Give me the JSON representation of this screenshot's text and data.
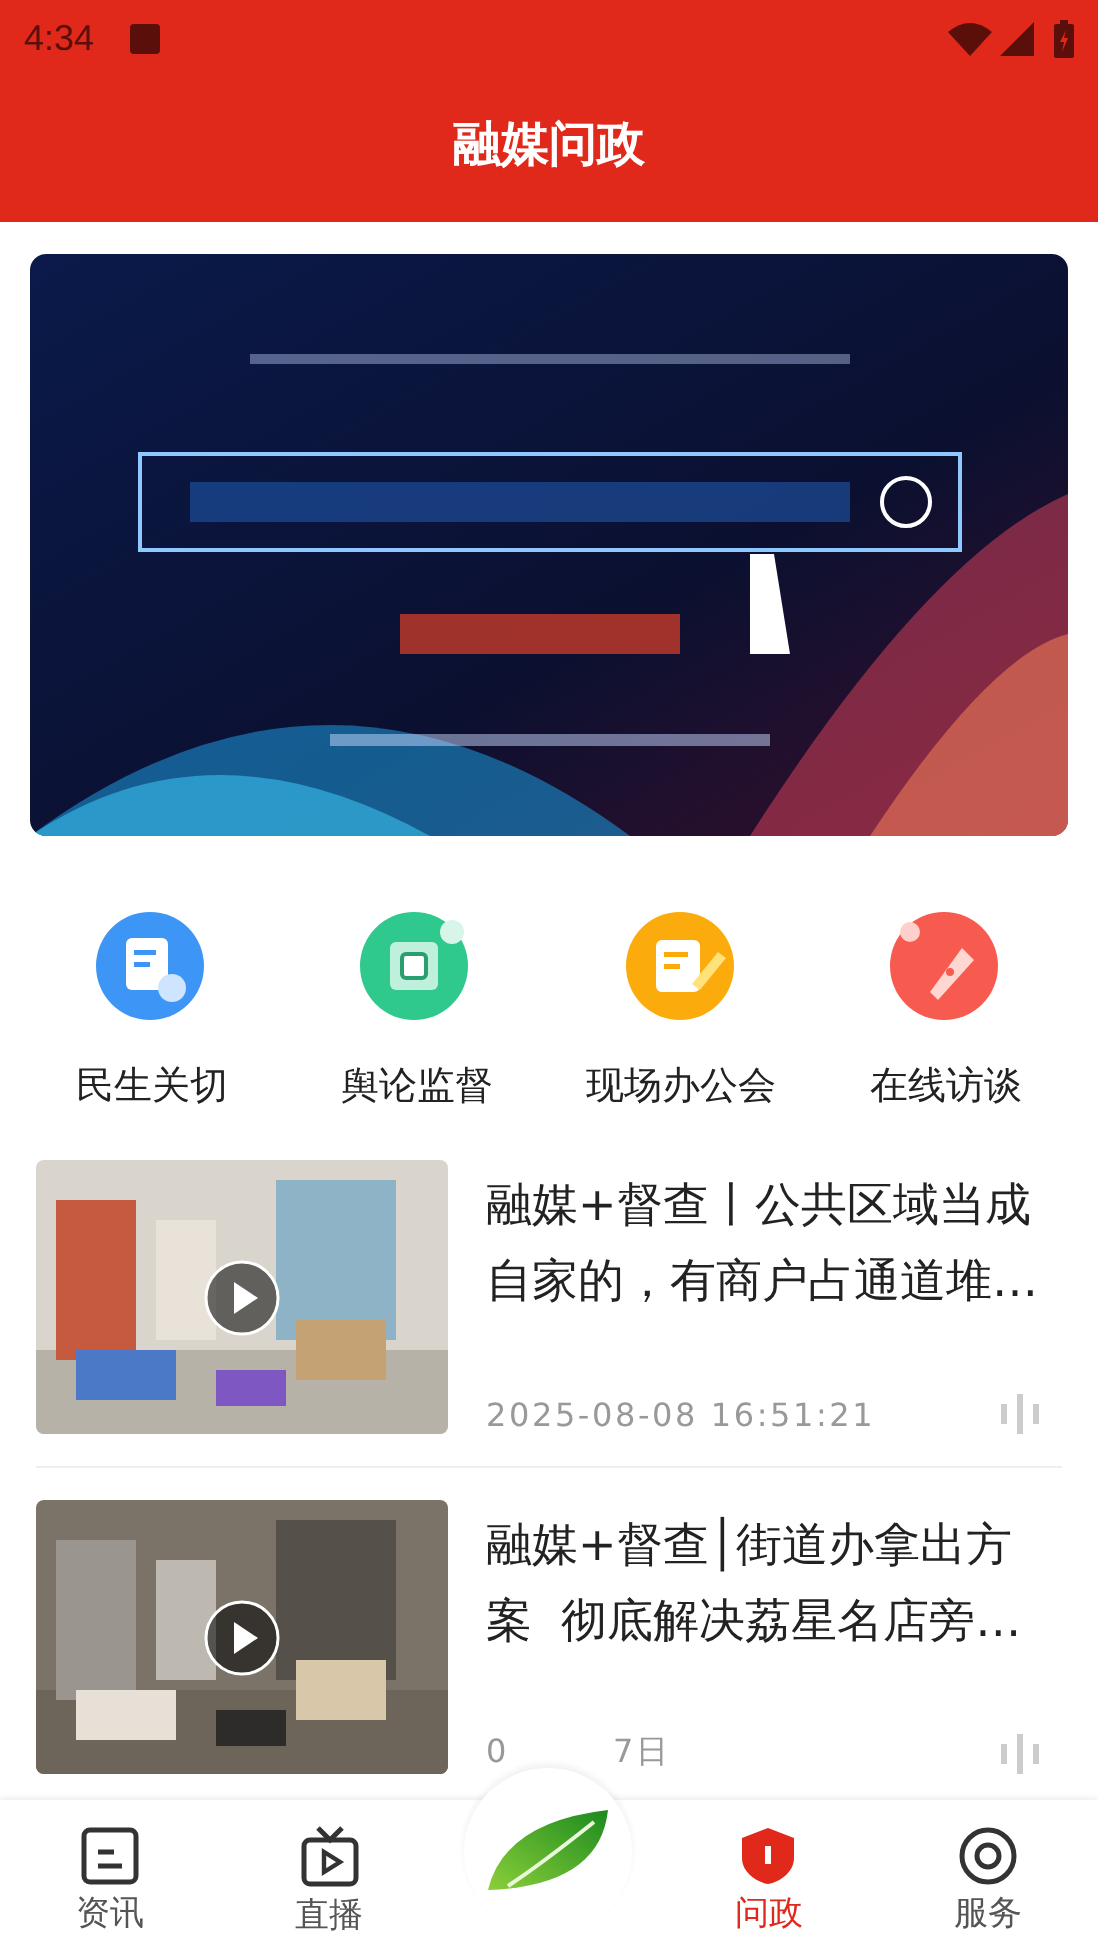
{
  "status_bar": {
    "time": "4:34"
  },
  "header": {
    "title": "融媒问政"
  },
  "shortcuts": [
    {
      "label": "民生关切",
      "kind": "doc",
      "color": "#3d96f5"
    },
    {
      "label": "舆论监督",
      "kind": "chip",
      "color": "#2fc98d"
    },
    {
      "label": "现场办公会",
      "kind": "note",
      "color": "#fcab0c"
    },
    {
      "label": "在线访谈",
      "kind": "mic",
      "color": "#f75a4e"
    }
  ],
  "articles": [
    {
      "title_lines": [
        "融媒+督查丨公共区域当成",
        "自家的，有商户占通道堆…"
      ],
      "date_parts": [
        "2025-08-08 16:51:21"
      ],
      "video": true
    },
    {
      "title_lines": [
        "融媒+督查│街道办拿出方",
        "案  彻底解决荔星名店旁…"
      ],
      "date_parts": [
        "0",
        "7日"
      ],
      "video": true
    }
  ],
  "tab_bar": [
    {
      "label": "资讯",
      "kind": "doc",
      "selected": false
    },
    {
      "label": "直播",
      "kind": "tv",
      "selected": false
    },
    {
      "kind": "leaf",
      "selected": false
    },
    {
      "label": "问政",
      "kind": "shield",
      "selected": true
    },
    {
      "label": "服务",
      "kind": "ring",
      "selected": false
    }
  ]
}
